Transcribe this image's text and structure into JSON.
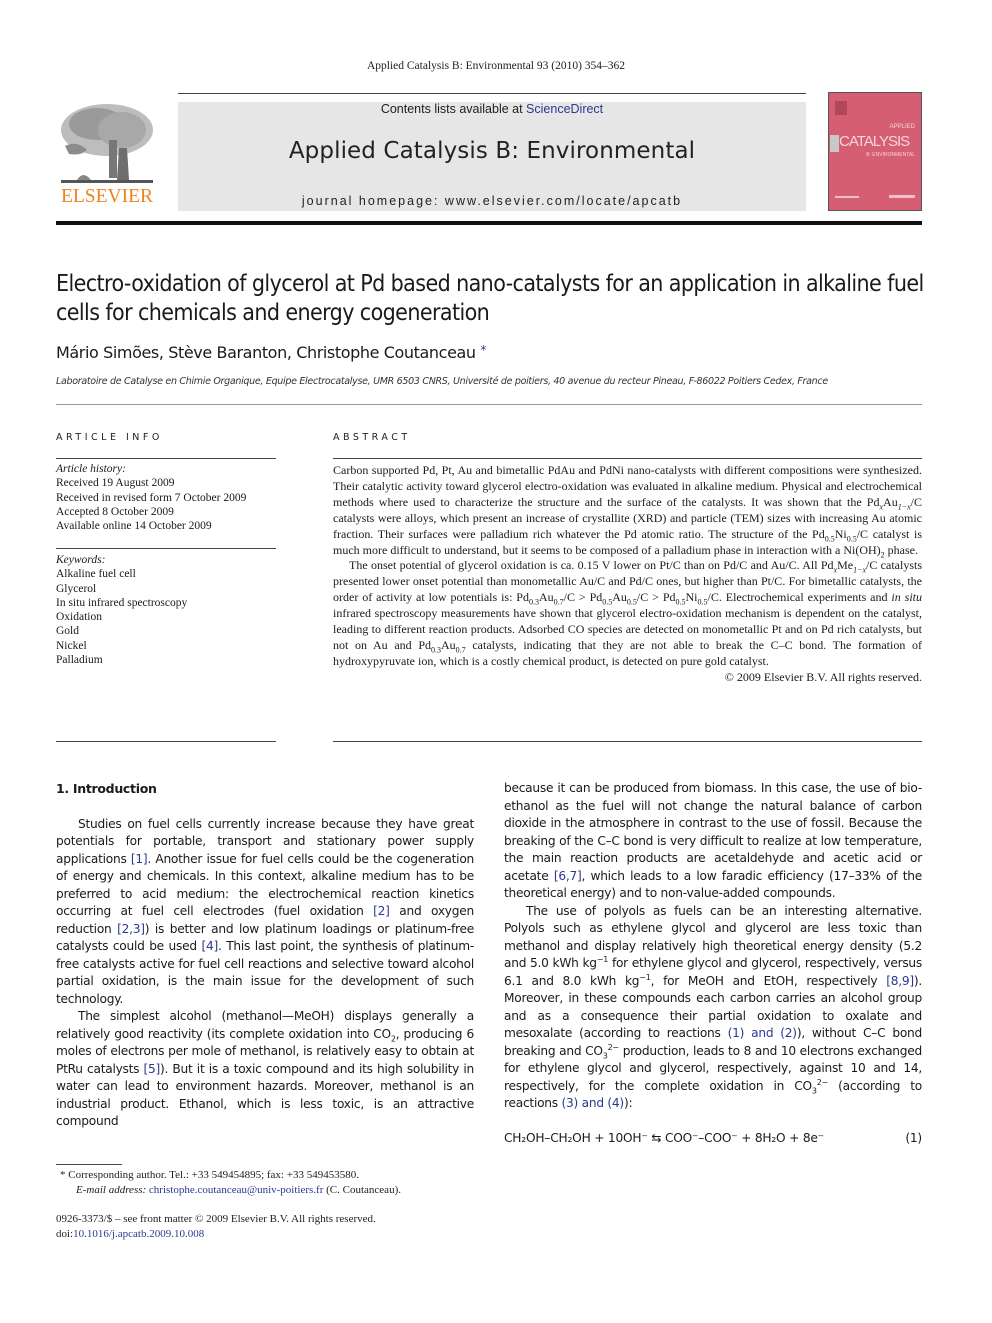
{
  "running_head": "Applied Catalysis B: Environmental 93 (2010) 354–362",
  "masthead": {
    "publisher_wordmark": "ELSEVIER",
    "contents_prefix": "Contents lists available at ",
    "contents_link": "ScienceDirect",
    "journal_title": "Applied Catalysis B: Environmental",
    "homepage": "journal homepage: www.elsevier.com/locate/apcatb",
    "cover": {
      "title": "CATALYSIS",
      "top_text": "APPLIED",
      "sub_text": "B: ENVIRONMENTAL",
      "color": "#d55e73"
    },
    "publisher_color": "#f0821e",
    "link_color": "#2b3990"
  },
  "article": {
    "title": "Electro-oxidation of glycerol at Pd based nano-catalysts for an application in alkaline fuel cells for chemicals and energy cogeneration",
    "authors": "Mário Simões, Stève Baranton, Christophe Coutanceau",
    "corresponding_mark": "*",
    "affiliation": "Laboratoire de Catalyse en Chimie Organique, Equipe Electrocatalyse, UMR 6503 CNRS, Université de poitiers, 40 avenue du recteur Pineau, F-86022 Poitiers Cedex, France"
  },
  "article_info": {
    "heading": "ARTICLE INFO",
    "history_label": "Article history:",
    "history": [
      "Received 19 August 2009",
      "Received in revised form 7 October 2009",
      "Accepted 8 October 2009",
      "Available online 14 October 2009"
    ],
    "keywords_label": "Keywords:",
    "keywords": [
      "Alkaline fuel cell",
      "Glycerol",
      "In situ infrared spectroscopy",
      "Oxidation",
      "Gold",
      "Nickel",
      "Palladium"
    ]
  },
  "abstract": {
    "heading": "ABSTRACT",
    "p1": {
      "a": "Carbon supported Pd, Pt, Au and bimetallic PdAu and PdNi nano-catalysts with different compositions were synthesized. Their catalytic activity toward glycerol electro-oxidation was evaluated in alkaline medium. Physical and electrochemical methods where used to characterize the structure and the surface of the catalysts. It was shown that the Pd",
      "b": "Au",
      "c": "/C catalysts were alloys, which present an increase of crystallite (XRD) and particle (TEM) sizes with increasing Au atomic fraction. Their surfaces were palladium rich whatever the Pd atomic ratio. The structure of the Pd",
      "d": "Ni",
      "e": "/C catalyst is much more difficult to understand, but it seems to be composed of a palladium phase in interaction with a Ni(OH)",
      "f": " phase.",
      "sub_x": "x",
      "sub_1mx": "1−x",
      "sub_05": "0.5",
      "sub_2": "2"
    },
    "p2": {
      "a": "The onset potential of glycerol oxidation is ca. 0.15 V lower on Pt/C than on Pd/C and Au/C. All Pd",
      "b": "Me",
      "c": "/C catalysts presented lower onset potential than monometallic Au/C and Pd/C ones, but higher than Pt/C. For bimetallic catalysts, the order of activity at low potentials is: Pd",
      "d": "Au",
      "e": "/C > Pd",
      "f": "Au",
      "g": "/C > Pd",
      "h": "Ni",
      "i": "/C. Electrochemical experiments and ",
      "j": "in situ",
      "k": " infrared spectroscopy measurements have shown that glycerol electro-oxidation mechanism is dependent on the catalyst, leading to different reaction products. Adsorbed CO species are detected on monometallic Pt and on Pd rich catalysts, but not on Au and Pd",
      "l": "Au",
      "m": " catalysts, indicating that they are not able to break the C–C bond. The formation of hydroxypyruvate ion, which is a costly chemical product, is detected on pure gold catalyst.",
      "sub_03": "0.3",
      "sub_07": "0.7"
    },
    "copyright": "© 2009 Elsevier B.V. All rights reserved."
  },
  "body": {
    "section_title": "1.  Introduction",
    "left": {
      "p1": {
        "a": "Studies on fuel cells currently increase because they have great potentials for portable, transport and stationary power supply applications ",
        "r1": "[1]",
        "b": ". Another issue for fuel cells could be the cogeneration of energy and chemicals. In this context, alkaline medium has to be preferred to acid medium: the electrochemical reaction kinetics occurring at fuel cell electrodes (fuel oxidation ",
        "r2": "[2]",
        "c": " and oxygen reduction ",
        "r3": "[2,3]",
        "d": ") is better and low platinum loadings or platinum-free catalysts could be used ",
        "r4": "[4]",
        "e": ". This last point, the synthesis of platinum-free catalysts active for fuel cell reactions and selective toward alcohol partial oxidation, is the main issue for the development of such technology."
      },
      "p2": {
        "a": "The simplest alcohol (methanol—MeOH) displays generally a relatively good reactivity (its complete oxidation into CO",
        "sub": "2",
        "b": ", producing 6 moles of electrons per mole of methanol, is relatively easy to obtain at PtRu catalysts ",
        "r5": "[5]",
        "c": "). But it is a toxic compound and its high solubility in water can lead to environment hazards. Moreover, methanol is an industrial product. Ethanol, which is less toxic, is an attractive compound"
      }
    },
    "right": {
      "p1": {
        "a": "because it can be produced from biomass. In this case, the use of bio-ethanol as the fuel will not change the natural balance of carbon dioxide in the atmosphere in contrast to the use of fossil. Because the breaking of the C–C bond is very difficult to realize at low temperature, the main reaction products are acetaldehyde and acetic acid or acetate ",
        "r67": "[6,7]",
        "b": ", which leads to a low faradic efficiency (17–33% of the theoretical energy) and to non-value-added compounds."
      },
      "p2": {
        "a": "The use of polyols as fuels can be an interesting alternative. Polyols such as ethylene glycol and glycerol are less toxic than methanol and display relatively high theoretical energy density (5.2 and 5.0 kWh kg",
        "sup_m1": "−1",
        "b": " for ethylene glycol and glycerol, respectively, versus 6.1 and 8.0 kWh kg",
        "c": ", for MeOH and EtOH, respectively ",
        "r89": "[8,9]",
        "d": "). Moreover, in these compounds each carbon carries an alcohol group and as a consequence their partial oxidation to oxalate and mesoxalate (according to reactions ",
        "eq12": "(1) and (2)",
        "e": "), without C–C bond breaking and CO",
        "sub3": "3",
        "sup2m": "2−",
        "f": " production, leads to 8 and 10 electrons exchanged for ethylene glycol and glycerol, respectively, against 10 and 14, respectively, for the complete oxidation in CO",
        "g": " (according to reactions ",
        "eq34": "(3) and (4)",
        "h": "):"
      },
      "equation": {
        "lhs": "CH₂OH–CH₂OH + 10OH⁻ ⇆ COO⁻–COO⁻ + 8H₂O + 8e⁻",
        "number": "(1)"
      }
    }
  },
  "footnotes": {
    "corresponding": "* Corresponding author. Tel.: +33 549454895; fax: +33 549453580.",
    "email_label": "E-mail address: ",
    "email": "christophe.coutanceau@univ-poitiers.fr",
    "email_suffix": " (C. Coutanceau).",
    "issn_line": "0926-3373/$ – see front matter © 2009 Elsevier B.V. All rights reserved.",
    "doi_prefix": "doi:",
    "doi": "10.1016/j.apcatb.2009.10.008"
  }
}
